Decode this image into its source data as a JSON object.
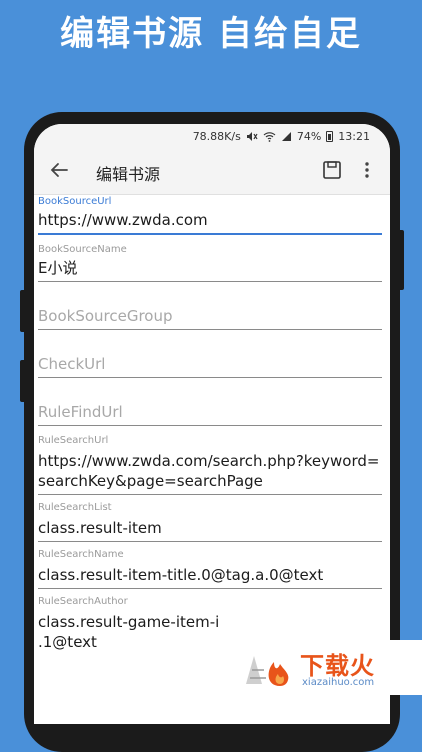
{
  "promo": {
    "headline": "编辑书源 自给自足"
  },
  "statusbar": {
    "speed": "78.88K/s",
    "battery": "74%",
    "time": "13:21"
  },
  "toolbar": {
    "title": "编辑书源"
  },
  "fields": [
    {
      "label": "BookSourceUrl",
      "value": "https://www.zwda.com"
    },
    {
      "label": "BookSourceName",
      "value": "E小说"
    },
    {
      "placeholder": "BookSourceGroup"
    },
    {
      "placeholder": "CheckUrl"
    },
    {
      "placeholder": "RuleFindUrl"
    },
    {
      "label": "RuleSearchUrl",
      "value": "https://www.zwda.com/search.php?keyword=searchKey&page=searchPage"
    },
    {
      "label": "RuleSearchList",
      "value": "class.result-item"
    },
    {
      "label": "RuleSearchName",
      "value": "class.result-item-title.0@tag.a.0@text"
    },
    {
      "label": "RuleSearchAuthor",
      "value": "class.result-game-item-i",
      "value2": ".1@text"
    }
  ],
  "watermark": {
    "text": "下载火",
    "sub": "xiazaihuo.com"
  },
  "colors": {
    "background": "#4a90d9",
    "accent": "#3a7bd5",
    "watermark": "#e8541a"
  }
}
